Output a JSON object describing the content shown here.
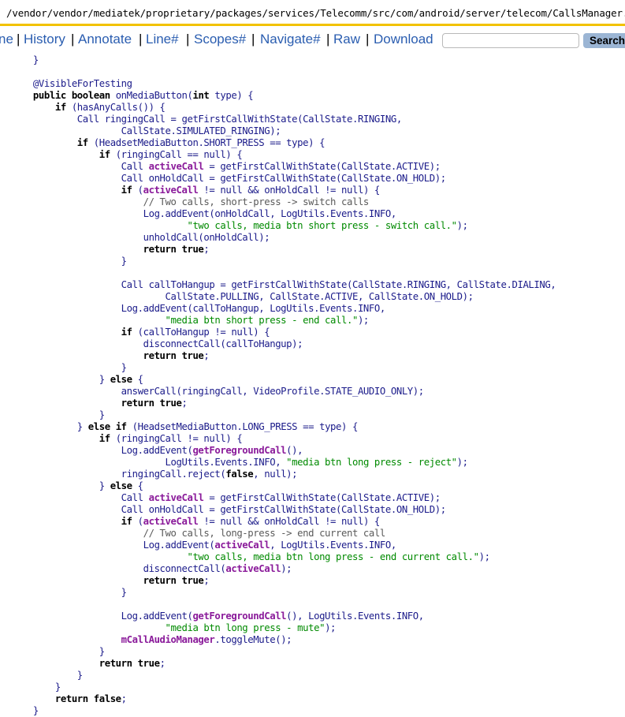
{
  "path": "/vendor/vendor/mediatek/proprietary/packages/services/Telecomm/src/com/android/server/telecom/CallsManager.java",
  "nav": {
    "items": [
      "ne",
      "History",
      "Annotate",
      "Line#",
      "Scopes#",
      "Navigate#",
      "Raw",
      "Download"
    ],
    "search_value": "",
    "search_label": "Search"
  },
  "code_lines": [
    [
      [
        "p",
        "    }"
      ]
    ],
    [
      [
        "p",
        ""
      ]
    ],
    [
      [
        "p",
        "    @VisibleForTesting"
      ]
    ],
    [
      [
        "k",
        "    public boolean "
      ],
      [
        "p",
        "onMediaButton("
      ],
      [
        "k",
        "int "
      ],
      [
        "p",
        "type) {"
      ]
    ],
    [
      [
        "k",
        "        if "
      ],
      [
        "p",
        "(hasAnyCalls()) {"
      ]
    ],
    [
      [
        "p",
        "            Call ringingCall = getFirstCallWithState(CallState.RINGING,"
      ]
    ],
    [
      [
        "p",
        "                    CallState.SIMULATED_RINGING);"
      ]
    ],
    [
      [
        "k",
        "            if "
      ],
      [
        "p",
        "(HeadsetMediaButton.SHORT_PRESS == type) {"
      ]
    ],
    [
      [
        "k",
        "                if "
      ],
      [
        "p",
        "(ringingCall == "
      ],
      [
        "p",
        "null"
      ],
      [
        "p",
        ") {"
      ]
    ],
    [
      [
        "p",
        "                    Call "
      ],
      [
        "f",
        "activeCall"
      ],
      [
        "p",
        " = getFirstCallWithState(CallState.ACTIVE);"
      ]
    ],
    [
      [
        "p",
        "                    Call onHoldCall = getFirstCallWithState(CallState.ON_HOLD);"
      ]
    ],
    [
      [
        "k",
        "                    if "
      ],
      [
        "p",
        "("
      ],
      [
        "f",
        "activeCall"
      ],
      [
        "p",
        " != null && onHoldCall != null) {"
      ]
    ],
    [
      [
        "c",
        "                        // Two calls, short-press -> switch calls"
      ]
    ],
    [
      [
        "p",
        "                        Log.addEvent(onHoldCall, LogUtils.Events.INFO,"
      ]
    ],
    [
      [
        "s",
        "                                \"two calls, media btn short press - switch call.\""
      ],
      [
        "p",
        ");"
      ]
    ],
    [
      [
        "p",
        "                        unholdCall(onHoldCall);"
      ]
    ],
    [
      [
        "k",
        "                        return true"
      ],
      [
        "p",
        ";"
      ]
    ],
    [
      [
        "p",
        "                    }"
      ]
    ],
    [
      [
        "p",
        ""
      ]
    ],
    [
      [
        "p",
        "                    Call callToHangup = getFirstCallWithState(CallState.RINGING, CallState.DIALING,"
      ]
    ],
    [
      [
        "p",
        "                            CallState.PULLING, CallState.ACTIVE, CallState.ON_HOLD);"
      ]
    ],
    [
      [
        "p",
        "                    Log.addEvent(callToHangup, LogUtils.Events.INFO,"
      ]
    ],
    [
      [
        "s",
        "                            \"media btn short press - end call.\""
      ],
      [
        "p",
        ");"
      ]
    ],
    [
      [
        "k",
        "                    if "
      ],
      [
        "p",
        "(callToHangup != null) {"
      ]
    ],
    [
      [
        "p",
        "                        disconnectCall(callToHangup);"
      ]
    ],
    [
      [
        "k",
        "                        return true"
      ],
      [
        "p",
        ";"
      ]
    ],
    [
      [
        "p",
        "                    }"
      ]
    ],
    [
      [
        "p",
        "                } "
      ],
      [
        "k",
        "else "
      ],
      [
        "p",
        "{"
      ]
    ],
    [
      [
        "p",
        "                    answerCall(ringingCall, VideoProfile.STATE_AUDIO_ONLY);"
      ]
    ],
    [
      [
        "k",
        "                    return true"
      ],
      [
        "p",
        ";"
      ]
    ],
    [
      [
        "p",
        "                }"
      ]
    ],
    [
      [
        "p",
        "            } "
      ],
      [
        "k",
        "else if "
      ],
      [
        "p",
        "(HeadsetMediaButton.LONG_PRESS == type) {"
      ]
    ],
    [
      [
        "k",
        "                if "
      ],
      [
        "p",
        "(ringingCall != null) {"
      ]
    ],
    [
      [
        "p",
        "                    Log.addEvent("
      ],
      [
        "f",
        "getForegroundCall"
      ],
      [
        "p",
        "(),"
      ]
    ],
    [
      [
        "p",
        "                            LogUtils.Events.INFO, "
      ],
      [
        "s",
        "\"media btn long press - reject\""
      ],
      [
        "p",
        ");"
      ]
    ],
    [
      [
        "p",
        "                    ringingCall.reject("
      ],
      [
        "k",
        "false"
      ],
      [
        "p",
        ", null);"
      ]
    ],
    [
      [
        "p",
        "                } "
      ],
      [
        "k",
        "else "
      ],
      [
        "p",
        "{"
      ]
    ],
    [
      [
        "p",
        "                    Call "
      ],
      [
        "f",
        "activeCall"
      ],
      [
        "p",
        " = getFirstCallWithState(CallState.ACTIVE);"
      ]
    ],
    [
      [
        "p",
        "                    Call onHoldCall = getFirstCallWithState(CallState.ON_HOLD);"
      ]
    ],
    [
      [
        "k",
        "                    if "
      ],
      [
        "p",
        "("
      ],
      [
        "f",
        "activeCall"
      ],
      [
        "p",
        " != null && onHoldCall != null) {"
      ]
    ],
    [
      [
        "c",
        "                        // Two calls, long-press -> end current call"
      ]
    ],
    [
      [
        "p",
        "                        Log.addEvent("
      ],
      [
        "f",
        "activeCall"
      ],
      [
        "p",
        ", LogUtils.Events.INFO,"
      ]
    ],
    [
      [
        "s",
        "                                \"two calls, media btn long press - end current call.\""
      ],
      [
        "p",
        ");"
      ]
    ],
    [
      [
        "p",
        "                        disconnectCall("
      ],
      [
        "f",
        "activeCall"
      ],
      [
        "p",
        ");"
      ]
    ],
    [
      [
        "k",
        "                        return true"
      ],
      [
        "p",
        ";"
      ]
    ],
    [
      [
        "p",
        "                    }"
      ]
    ],
    [
      [
        "p",
        ""
      ]
    ],
    [
      [
        "p",
        "                    Log.addEvent("
      ],
      [
        "f",
        "getForegroundCall"
      ],
      [
        "p",
        "(), LogUtils.Events.INFO,"
      ]
    ],
    [
      [
        "s",
        "                            \"media btn long press - mute\""
      ],
      [
        "p",
        ");"
      ]
    ],
    [
      [
        "f",
        "                    mCallAudioManager"
      ],
      [
        "p",
        ".toggleMute();"
      ]
    ],
    [
      [
        "p",
        "                }"
      ]
    ],
    [
      [
        "k",
        "                return true"
      ],
      [
        "p",
        ";"
      ]
    ],
    [
      [
        "p",
        "            }"
      ]
    ],
    [
      [
        "p",
        "        }"
      ]
    ],
    [
      [
        "k",
        "        return false"
      ],
      [
        "p",
        ";"
      ]
    ],
    [
      [
        "p",
        "    }"
      ]
    ]
  ]
}
